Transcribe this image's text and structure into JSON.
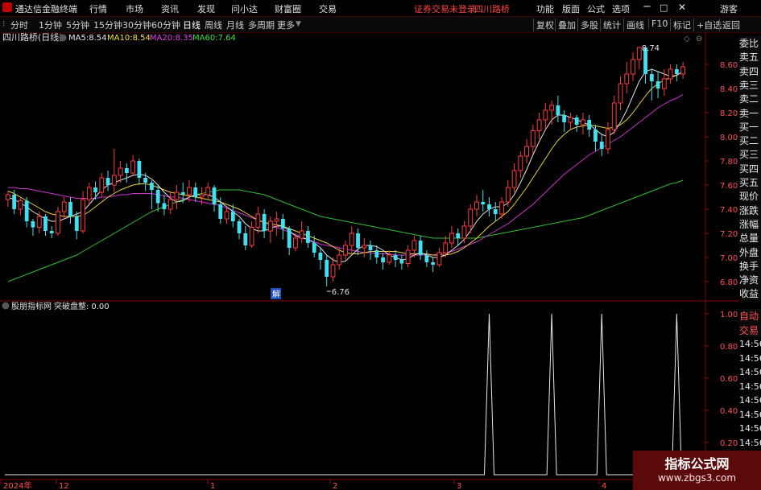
{
  "topbar": {
    "app_title": "通达信金融终端",
    "menu": [
      "行情",
      "市场",
      "资讯",
      "发现",
      "问小达",
      "财富圈",
      "交易"
    ],
    "warning": "证券交易未登录",
    "stock_name": "四川路桥",
    "right_menu": [
      "功能",
      "版面",
      "公式",
      "选项"
    ],
    "guest": "游客"
  },
  "toolbar": {
    "periods": [
      "分时",
      "1分钟",
      "5分钟",
      "15分钟",
      "30分钟",
      "60分钟",
      "日线",
      "周线",
      "月线",
      "多周期",
      "更多"
    ],
    "active": "日线",
    "right_buttons": [
      "复权",
      "叠加",
      "多股",
      "统计",
      "画线",
      "F10",
      "标记",
      "+自选",
      "返回"
    ]
  },
  "main_chart": {
    "title": "四川路桥(日线)",
    "ma": [
      {
        "label": "MA5:",
        "value": "8.54",
        "color": "#e8e8e8"
      },
      {
        "label": "MA10:",
        "value": "8.54",
        "color": "#f0e040"
      },
      {
        "label": "MA20:",
        "value": "8.35",
        "color": "#e040e0"
      },
      {
        "label": "MA60:",
        "value": "7.64",
        "color": "#40e040"
      }
    ],
    "y_ticks": [
      "8.60",
      "8.40",
      "8.20",
      "8.00",
      "7.80",
      "7.60",
      "7.40",
      "7.20",
      "7.00",
      "6.80"
    ],
    "high_label": "8.74",
    "low_label": "6.76",
    "marker": "解"
  },
  "indicator": {
    "name": "股朋指标网",
    "line_label": "突破盘整:",
    "line_value": "0.00",
    "y_ticks": [
      "1.00",
      "0.80",
      "0.60",
      "0.40",
      "0.20"
    ]
  },
  "x_axis": {
    "labels": [
      "2024年",
      "12",
      "1",
      "2",
      "3",
      "4"
    ]
  },
  "right_panel": {
    "top_labels": [
      "委比",
      "卖五",
      "卖四",
      "卖三",
      "卖二",
      "卖一",
      "买一",
      "买二",
      "买三",
      "买四",
      "买五",
      "现价",
      "涨跌",
      "涨幅",
      "总量",
      "外盘",
      "换手",
      "净资",
      "收益"
    ],
    "mid_labels": [
      "自动",
      "交易"
    ],
    "times": [
      "14:56",
      "14:56",
      "14:56",
      "14:56",
      "14:56",
      "14:56",
      "14:56",
      "14:56"
    ]
  },
  "watermark": {
    "title": "指标公式网",
    "url": "www.zbgs3.com"
  },
  "chart_data": [
    {
      "type": "candlestick",
      "title": "四川路桥(日线)",
      "xlabel": "",
      "ylabel": "",
      "ylim": [
        6.7,
        8.8
      ],
      "candles": [
        [
          7.48,
          7.52,
          7.42,
          7.55
        ],
        [
          7.52,
          7.4,
          7.36,
          7.56
        ],
        [
          7.4,
          7.47,
          7.35,
          7.5
        ],
        [
          7.47,
          7.3,
          7.25,
          7.5
        ],
        [
          7.3,
          7.25,
          7.18,
          7.32
        ],
        [
          7.25,
          7.34,
          7.2,
          7.38
        ],
        [
          7.34,
          7.22,
          7.18,
          7.36
        ],
        [
          7.22,
          7.2,
          7.16,
          7.26
        ],
        [
          7.2,
          7.38,
          7.18,
          7.42
        ],
        [
          7.38,
          7.46,
          7.32,
          7.5
        ],
        [
          7.46,
          7.34,
          7.28,
          7.5
        ],
        [
          7.34,
          7.22,
          7.15,
          7.38
        ],
        [
          7.22,
          7.48,
          7.2,
          7.55
        ],
        [
          7.48,
          7.58,
          7.44,
          7.62
        ],
        [
          7.58,
          7.54,
          7.48,
          7.63
        ],
        [
          7.54,
          7.66,
          7.5,
          7.7
        ],
        [
          7.66,
          7.6,
          7.55,
          7.72
        ],
        [
          7.6,
          7.68,
          7.54,
          7.9
        ],
        [
          7.68,
          7.74,
          7.62,
          7.8
        ],
        [
          7.74,
          7.7,
          7.62,
          7.78
        ],
        [
          7.7,
          7.8,
          7.68,
          7.85
        ],
        [
          7.8,
          7.66,
          7.6,
          7.82
        ],
        [
          7.66,
          7.62,
          7.55,
          7.7
        ],
        [
          7.62,
          7.56,
          7.4,
          7.64
        ],
        [
          7.56,
          7.45,
          7.38,
          7.6
        ],
        [
          7.45,
          7.4,
          7.35,
          7.52
        ],
        [
          7.4,
          7.48,
          7.36,
          7.55
        ],
        [
          7.48,
          7.54,
          7.4,
          7.6
        ],
        [
          7.54,
          7.52,
          7.45,
          7.62
        ],
        [
          7.52,
          7.58,
          7.46,
          7.64
        ],
        [
          7.58,
          7.5,
          7.46,
          7.62
        ],
        [
          7.5,
          7.52,
          7.44,
          7.58
        ],
        [
          7.52,
          7.58,
          7.48,
          7.62
        ],
        [
          7.58,
          7.44,
          7.38,
          7.6
        ],
        [
          7.44,
          7.32,
          7.28,
          7.5
        ],
        [
          7.32,
          7.38,
          7.28,
          7.42
        ],
        [
          7.38,
          7.3,
          7.25,
          7.44
        ],
        [
          7.3,
          7.2,
          7.15,
          7.32
        ],
        [
          7.2,
          7.1,
          7.06,
          7.26
        ],
        [
          7.1,
          7.25,
          7.08,
          7.3
        ],
        [
          7.25,
          7.36,
          7.2,
          7.42
        ],
        [
          7.36,
          7.22,
          7.16,
          7.4
        ],
        [
          7.22,
          7.3,
          7.12,
          7.34
        ],
        [
          7.3,
          7.32,
          7.18,
          7.38
        ],
        [
          7.32,
          7.24,
          7.15,
          7.36
        ],
        [
          7.24,
          7.08,
          7.02,
          7.26
        ],
        [
          7.08,
          7.16,
          7.05,
          7.2
        ],
        [
          7.16,
          7.22,
          7.12,
          7.3
        ],
        [
          7.22,
          7.12,
          7.08,
          7.26
        ],
        [
          7.12,
          7.04,
          7.0,
          7.18
        ],
        [
          7.04,
          6.98,
          6.9,
          7.08
        ],
        [
          6.98,
          6.84,
          6.76,
          7.02
        ],
        [
          6.84,
          6.94,
          6.8,
          7.0
        ],
        [
          6.94,
          7.02,
          6.9,
          7.08
        ],
        [
          7.02,
          7.1,
          6.98,
          7.14
        ],
        [
          7.1,
          7.2,
          7.04,
          7.26
        ],
        [
          7.2,
          7.08,
          7.02,
          7.24
        ],
        [
          7.08,
          7.1,
          7.0,
          7.16
        ],
        [
          7.1,
          7.06,
          6.98,
          7.14
        ],
        [
          7.06,
          7.0,
          6.95,
          7.1
        ],
        [
          7.0,
          6.96,
          6.9,
          7.04
        ],
        [
          6.96,
          7.02,
          6.94,
          7.06
        ],
        [
          7.02,
          6.98,
          6.92,
          7.06
        ],
        [
          6.98,
          6.95,
          6.9,
          7.02
        ],
        [
          6.95,
          7.06,
          6.92,
          7.1
        ],
        [
          7.06,
          7.14,
          7.0,
          7.18
        ],
        [
          7.14,
          7.02,
          6.98,
          7.18
        ],
        [
          7.02,
          6.96,
          6.92,
          7.06
        ],
        [
          6.96,
          6.94,
          6.88,
          7.0
        ],
        [
          6.94,
          7.04,
          6.92,
          7.08
        ],
        [
          7.04,
          7.12,
          7.0,
          7.18
        ],
        [
          7.12,
          7.2,
          7.08,
          7.26
        ],
        [
          7.2,
          7.16,
          7.1,
          7.24
        ],
        [
          7.16,
          7.26,
          7.12,
          7.3
        ],
        [
          7.26,
          7.4,
          7.2,
          7.44
        ],
        [
          7.4,
          7.46,
          7.34,
          7.52
        ],
        [
          7.46,
          7.44,
          7.38,
          7.56
        ],
        [
          7.44,
          7.4,
          7.34,
          7.5
        ],
        [
          7.4,
          7.36,
          7.3,
          7.46
        ],
        [
          7.36,
          7.46,
          7.32,
          7.5
        ],
        [
          7.46,
          7.58,
          7.42,
          7.64
        ],
        [
          7.58,
          7.72,
          7.54,
          7.78
        ],
        [
          7.72,
          7.84,
          7.66,
          7.88
        ],
        [
          7.84,
          7.92,
          7.78,
          7.98
        ],
        [
          7.92,
          8.05,
          7.86,
          8.1
        ],
        [
          8.05,
          8.14,
          7.98,
          8.2
        ],
        [
          8.14,
          8.22,
          8.06,
          8.28
        ],
        [
          8.22,
          8.26,
          8.1,
          8.3
        ],
        [
          8.26,
          8.18,
          8.12,
          8.34
        ],
        [
          8.18,
          8.12,
          8.04,
          8.22
        ],
        [
          8.12,
          8.16,
          8.06,
          8.2
        ],
        [
          8.16,
          8.1,
          8.04,
          8.18
        ],
        [
          8.1,
          8.14,
          8.02,
          8.2
        ],
        [
          8.14,
          8.06,
          8.0,
          8.18
        ],
        [
          8.06,
          7.96,
          7.88,
          8.1
        ],
        [
          7.96,
          7.9,
          7.84,
          8.02
        ],
        [
          7.9,
          8.06,
          7.86,
          8.12
        ],
        [
          8.06,
          8.28,
          8.02,
          8.34
        ],
        [
          8.28,
          8.44,
          8.22,
          8.5
        ],
        [
          8.44,
          8.52,
          8.36,
          8.62
        ],
        [
          8.52,
          8.64,
          8.46,
          8.7
        ],
        [
          8.64,
          8.74,
          8.56,
          8.74
        ],
        [
          8.74,
          8.52,
          8.44,
          8.74
        ],
        [
          8.52,
          8.46,
          8.3,
          8.56
        ],
        [
          8.46,
          8.4,
          8.32,
          8.54
        ],
        [
          8.4,
          8.48,
          8.34,
          8.56
        ],
        [
          8.48,
          8.56,
          8.44,
          8.6
        ],
        [
          8.56,
          8.52,
          8.46,
          8.6
        ],
        [
          8.52,
          8.58,
          8.48,
          8.62
        ]
      ],
      "ma5": [
        7.5,
        7.48,
        7.45,
        7.42,
        7.38,
        7.35,
        7.32,
        7.3,
        7.3,
        7.32,
        7.34,
        7.36,
        7.38,
        7.44,
        7.5,
        7.56,
        7.6,
        7.62,
        7.64,
        7.66,
        7.68,
        7.69,
        7.68,
        7.65,
        7.6,
        7.54,
        7.49,
        7.46,
        7.47,
        7.5,
        7.52,
        7.52,
        7.52,
        7.5,
        7.46,
        7.42,
        7.38,
        7.34,
        7.28,
        7.24,
        7.22,
        7.22,
        7.24,
        7.26,
        7.26,
        7.22,
        7.18,
        7.16,
        7.15,
        7.12,
        7.08,
        7.02,
        6.98,
        6.96,
        6.97,
        7.02,
        7.07,
        7.1,
        7.1,
        7.09,
        7.06,
        7.02,
        7.0,
        6.98,
        6.99,
        7.02,
        7.04,
        7.02,
        7.0,
        7.0,
        7.02,
        7.06,
        7.1,
        7.15,
        7.22,
        7.3,
        7.36,
        7.4,
        7.42,
        7.42,
        7.45,
        7.52,
        7.62,
        7.73,
        7.85,
        7.96,
        8.06,
        8.14,
        8.18,
        8.18,
        8.16,
        8.14,
        8.12,
        8.1,
        8.06,
        8.02,
        8.0,
        8.04,
        8.12,
        8.22,
        8.34,
        8.46,
        8.54,
        8.56,
        8.54,
        8.52,
        8.5,
        8.51,
        8.54
      ],
      "ma10": [
        7.55,
        7.53,
        7.5,
        7.47,
        7.44,
        7.41,
        7.38,
        7.36,
        7.35,
        7.34,
        7.34,
        7.34,
        7.35,
        7.38,
        7.42,
        7.46,
        7.5,
        7.53,
        7.56,
        7.58,
        7.6,
        7.61,
        7.61,
        7.6,
        7.58,
        7.56,
        7.54,
        7.53,
        7.52,
        7.51,
        7.5,
        7.49,
        7.48,
        7.47,
        7.46,
        7.44,
        7.42,
        7.4,
        7.37,
        7.34,
        7.31,
        7.29,
        7.28,
        7.27,
        7.26,
        7.24,
        7.22,
        7.2,
        7.18,
        7.16,
        7.14,
        7.12,
        7.09,
        7.06,
        7.04,
        7.03,
        7.03,
        7.04,
        7.05,
        7.05,
        7.05,
        7.05,
        7.05,
        7.04,
        7.03,
        7.03,
        7.03,
        7.03,
        7.02,
        7.02,
        7.02,
        7.03,
        7.05,
        7.08,
        7.12,
        7.16,
        7.21,
        7.26,
        7.3,
        7.34,
        7.38,
        7.44,
        7.51,
        7.58,
        7.66,
        7.74,
        7.82,
        7.9,
        7.97,
        8.02,
        8.06,
        8.08,
        8.09,
        8.1,
        8.09,
        8.08,
        8.07,
        8.08,
        8.1,
        8.14,
        8.2,
        8.27,
        8.34,
        8.4,
        8.44,
        8.47,
        8.49,
        8.51,
        8.54
      ],
      "ma20": [
        7.58,
        7.58,
        7.57,
        7.57,
        7.56,
        7.55,
        7.54,
        7.53,
        7.52,
        7.51,
        7.5,
        7.49,
        7.49,
        7.49,
        7.49,
        7.5,
        7.5,
        7.51,
        7.52,
        7.52,
        7.53,
        7.53,
        7.53,
        7.53,
        7.52,
        7.51,
        7.5,
        7.5,
        7.49,
        7.48,
        7.47,
        7.46,
        7.45,
        7.44,
        7.43,
        7.41,
        7.39,
        7.37,
        7.35,
        7.33,
        7.31,
        7.29,
        7.27,
        7.25,
        7.23,
        7.21,
        7.19,
        7.17,
        7.15,
        7.13,
        7.11,
        7.1,
        7.09,
        7.08,
        7.07,
        7.06,
        7.05,
        7.04,
        7.04,
        7.03,
        7.03,
        7.03,
        7.02,
        7.02,
        7.02,
        7.02,
        7.02,
        7.02,
        7.02,
        7.03,
        7.04,
        7.05,
        7.07,
        7.09,
        7.11,
        7.13,
        7.16,
        7.19,
        7.22,
        7.25,
        7.28,
        7.32,
        7.36,
        7.4,
        7.44,
        7.49,
        7.54,
        7.59,
        7.64,
        7.69,
        7.73,
        7.77,
        7.81,
        7.85,
        7.88,
        7.91,
        7.94,
        7.97,
        8.0,
        8.04,
        8.08,
        8.12,
        8.16,
        8.2,
        8.24,
        8.27,
        8.3,
        8.32,
        8.35
      ],
      "ma60": [
        6.8,
        6.82,
        6.84,
        6.86,
        6.88,
        6.9,
        6.92,
        6.94,
        6.96,
        6.98,
        7.0,
        7.02,
        7.05,
        7.08,
        7.11,
        7.14,
        7.17,
        7.2,
        7.23,
        7.26,
        7.29,
        7.32,
        7.35,
        7.38,
        7.4,
        7.42,
        7.44,
        7.46,
        7.48,
        7.5,
        7.52,
        7.53,
        7.54,
        7.55,
        7.56,
        7.56,
        7.56,
        7.56,
        7.55,
        7.54,
        7.53,
        7.52,
        7.5,
        7.48,
        7.46,
        7.44,
        7.42,
        7.4,
        7.38,
        7.36,
        7.34,
        7.33,
        7.32,
        7.31,
        7.3,
        7.29,
        7.28,
        7.27,
        7.26,
        7.25,
        7.24,
        7.23,
        7.22,
        7.21,
        7.2,
        7.19,
        7.18,
        7.17,
        7.16,
        7.16,
        7.16,
        7.16,
        7.16,
        7.16,
        7.16,
        7.16,
        7.17,
        7.18,
        7.19,
        7.2,
        7.21,
        7.22,
        7.23,
        7.24,
        7.25,
        7.26,
        7.27,
        7.28,
        7.29,
        7.3,
        7.31,
        7.32,
        7.33,
        7.35,
        7.37,
        7.39,
        7.41,
        7.43,
        7.45,
        7.47,
        7.49,
        7.51,
        7.53,
        7.55,
        7.57,
        7.59,
        7.61,
        7.62,
        7.64
      ]
    },
    {
      "type": "line",
      "title": "股朋指标网",
      "series": [
        {
          "name": "突破盘整",
          "spikes_at_index": [
            77,
            87,
            95,
            107
          ],
          "values_note": "0 except 1.00 at spikes"
        }
      ],
      "ylim": [
        0,
        1
      ]
    }
  ]
}
